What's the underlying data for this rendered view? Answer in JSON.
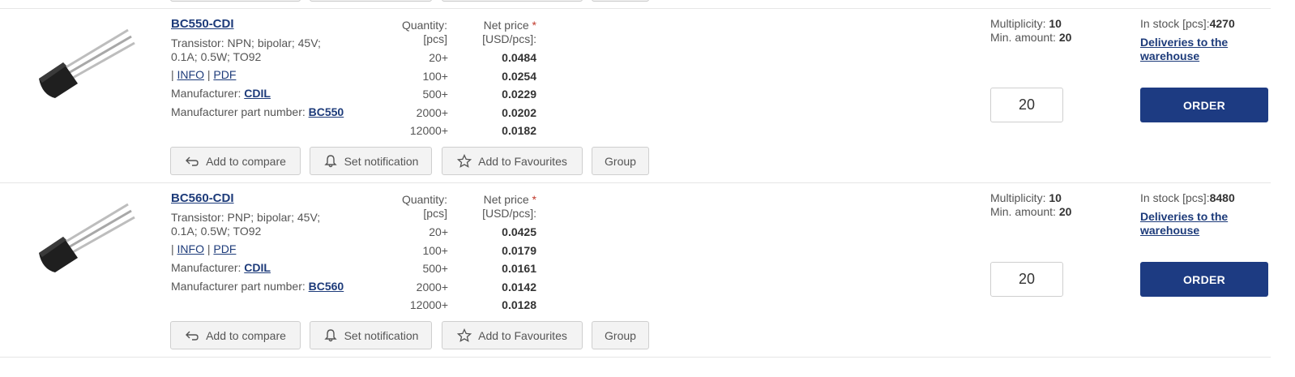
{
  "products": [
    {
      "code": "BC550-CDI",
      "description": "Transistor: NPN; bipolar; 45V; 0.1A; 0.5W; TO92",
      "links_prefix": "| ",
      "info_label": "INFO",
      "link_sep": " | ",
      "pdf_label": "PDF",
      "manufacturer_label": "Manufacturer: ",
      "manufacturer": "CDIL",
      "mpn_label": "Manufacturer part number: ",
      "mpn": "BC550",
      "quantity_header_1": "Quantity:",
      "quantity_header_2": "[pcs]",
      "price_header_1": "Net price",
      "price_header_star": "*",
      "price_header_2": "[USD/pcs]:",
      "tiers": [
        {
          "qty": "20+",
          "price": "0.0484"
        },
        {
          "qty": "100+",
          "price": "0.0254"
        },
        {
          "qty": "500+",
          "price": "0.0229"
        },
        {
          "qty": "2000+",
          "price": "0.0202"
        },
        {
          "qty": "12000+",
          "price": "0.0182"
        }
      ],
      "multiplicity_label": "Multiplicity: ",
      "multiplicity": "10",
      "min_amount_label": "Min. amount: ",
      "min_amount": "20",
      "stock_label": "In stock [pcs]:",
      "stock": "4270",
      "deliveries_label": "Deliveries to the warehouse",
      "qty_value": "20",
      "order_label": "ORDER"
    },
    {
      "code": "BC560-CDI",
      "description": "Transistor: PNP; bipolar; 45V; 0.1A; 0.5W; TO92",
      "links_prefix": "| ",
      "info_label": "INFO",
      "link_sep": " | ",
      "pdf_label": "PDF",
      "manufacturer_label": "Manufacturer: ",
      "manufacturer": "CDIL",
      "mpn_label": "Manufacturer part number: ",
      "mpn": "BC560",
      "quantity_header_1": "Quantity:",
      "quantity_header_2": "[pcs]",
      "price_header_1": "Net price",
      "price_header_star": "*",
      "price_header_2": "[USD/pcs]:",
      "tiers": [
        {
          "qty": "20+",
          "price": "0.0425"
        },
        {
          "qty": "100+",
          "price": "0.0179"
        },
        {
          "qty": "500+",
          "price": "0.0161"
        },
        {
          "qty": "2000+",
          "price": "0.0142"
        },
        {
          "qty": "12000+",
          "price": "0.0128"
        }
      ],
      "multiplicity_label": "Multiplicity: ",
      "multiplicity": "10",
      "min_amount_label": "Min. amount: ",
      "min_amount": "20",
      "stock_label": "In stock [pcs]:",
      "stock": "8480",
      "deliveries_label": "Deliveries to the warehouse",
      "qty_value": "20",
      "order_label": "ORDER"
    }
  ],
  "actions": {
    "compare_label": "Add to compare",
    "notify_label": "Set notification",
    "favourites_label": "Add to Favourites",
    "group_label": "Group"
  },
  "colors": {
    "link": "#1d3b7a",
    "order_button": "#1d3b82",
    "required_star": "#c0392b"
  }
}
